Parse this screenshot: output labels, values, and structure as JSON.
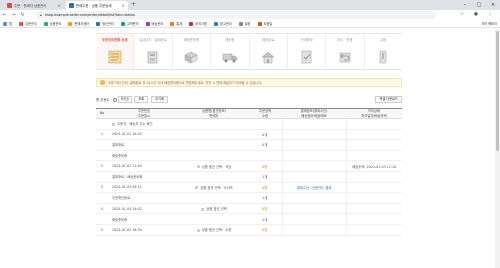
{
  "browser": {
    "tabs": [
      {
        "title": "주문 · 판매자 상품관리"
      },
      {
        "title": "판매주문 · 상품 주문상세"
      }
    ],
    "url": "shop.example-seller.com/order/detail/list?tab=status",
    "bookmarks": [
      "앱",
      "주문관리",
      "상품관리",
      "판매자센터",
      "정산관리",
      "고객문의",
      "배송관리",
      "통계",
      "공지사항",
      "광고관리",
      "설정",
      "도움말"
    ],
    "more_bookmarks": "기타 북마크",
    "colors": {
      "accent": "#e74c3c",
      "orange": "#e67e22",
      "link": "#2f6fb3"
    }
  },
  "steps": [
    {
      "label": "주문처리현황 상세",
      "icon": "order-list-icon"
    },
    {
      "label": "입금대기 · 결제완료",
      "icon": "payment-icon"
    },
    {
      "label": "배송준비중",
      "icon": "box-icon"
    },
    {
      "label": "배송중",
      "icon": "truck-icon"
    },
    {
      "label": "배송완료",
      "icon": "home-delivery-icon"
    },
    {
      "label": "구매확정",
      "icon": "check-doc-icon"
    },
    {
      "label": "취소 · 반품",
      "icon": "return-icon"
    },
    {
      "label": "교환",
      "icon": "exchange-icon"
    }
  ],
  "notice": {
    "text": "주문 처리 안내: 결제완료 후 24시간 이내 배송준비중으로 변경해주세요. 지연 시 판매 페널티가 부과될 수 있습니다."
  },
  "filter": {
    "total_label": "총 주문수",
    "select_label": "최신순",
    "button_search": "조회",
    "button_reset": "초기화",
    "button_excel": "엑셀 다운로드"
  },
  "table": {
    "headers": [
      {
        "l1": "No",
        "l2": ""
      },
      {
        "l1": "주문번호",
        "l2": "주문일시"
      },
      {
        "l1": "상품명(옵션정보)",
        "l2": "판매자"
      },
      {
        "l1": "주문금액",
        "l2": "수량"
      },
      {
        "l1": "결제정보(결제수단)",
        "l2": "배송정보/배송메모"
      },
      {
        "l1": "처리상태",
        "l2": "처리일자/배송추적"
      }
    ],
    "rows": [
      {
        "no": "",
        "c1": "주문자 · 배송지 주소 확인",
        "c2": "",
        "c3": "",
        "c4": "",
        "c5": ""
      },
      {
        "no": "1",
        "c1": "2024-01-01 10:25",
        "c2": "",
        "c3": "0개",
        "c4": "",
        "c5": ""
      },
      {
        "no": "",
        "c1": "결제완료",
        "c2": "",
        "c3": "0개",
        "c4": "",
        "c5": ""
      },
      {
        "no": "",
        "c1": "배송준비중",
        "c2": "",
        "c3": "",
        "c4": "",
        "c5": ""
      },
      {
        "no": "2",
        "c1": "2024-01-02 11:40",
        "c2": "상품 옵션 선택 · 색상",
        "c3": "0원",
        "c4": "",
        "c5": "배송추적: 2024-01-03 12:10"
      },
      {
        "no": "",
        "c1": "결제완료 · 배송준비중",
        "c2": "",
        "c3": "1개",
        "c4": "",
        "c5": ""
      },
      {
        "no": "3",
        "c1": "2024-01-03 09:15",
        "c2": "상품 옵션 선택 · 사이즈",
        "c3": "0원",
        "c4": "결제수단 · 신용카드 결제",
        "c5": ""
      },
      {
        "no": "",
        "c1": "주문확인완료",
        "c2": "",
        "c3": "1개",
        "c4": "",
        "c5": ""
      },
      {
        "no": "4",
        "c1": "2024-01-04 14:02",
        "c2": "상품 옵션 선택",
        "c3": "0원",
        "c4": "",
        "c5": ""
      },
      {
        "no": "",
        "c1": "배송준비중",
        "c2": "",
        "c3": "1개",
        "c4": "",
        "c5": ""
      },
      {
        "no": "5",
        "c1": "2024-01-05 16:30",
        "c2": "상품 옵션 선택 · 수량",
        "c3": "0원",
        "c4": "",
        "c5": ""
      }
    ]
  }
}
